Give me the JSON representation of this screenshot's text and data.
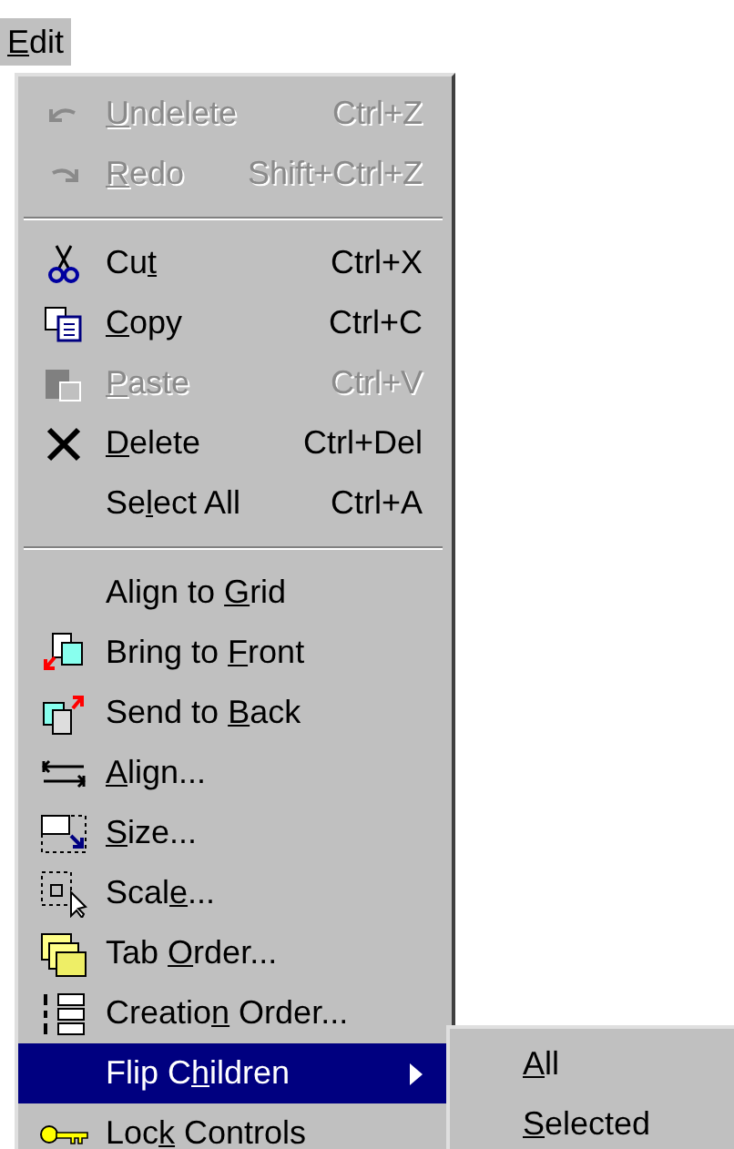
{
  "menu_bar": [
    {
      "label": {
        "key": "E",
        "after": "dit"
      },
      "selected": true
    }
  ],
  "menu": {
    "groups": [
      [
        {
          "kind": "command",
          "label": {
            "key": "U",
            "after": "ndelete"
          },
          "shortcut": "Ctrl+Z",
          "disabled": true
        },
        {
          "kind": "command",
          "label": {
            "key": "R",
            "after": "edo"
          },
          "shortcut": "Shift+Ctrl+Z",
          "disabled": true
        }
      ],
      [
        {
          "kind": "command",
          "label": {
            "before": "Cu",
            "key": "t"
          },
          "shortcut": "Ctrl+X",
          "disabled": false
        },
        {
          "kind": "command",
          "label": {
            "key": "C",
            "after": "opy"
          },
          "shortcut": "Ctrl+C",
          "disabled": false
        },
        {
          "kind": "command",
          "label": {
            "key": "P",
            "after": "aste"
          },
          "shortcut": "Ctrl+V",
          "disabled": true
        },
        {
          "kind": "command",
          "label": {
            "key": "D",
            "after": "elete"
          },
          "shortcut": "Ctrl+Del",
          "disabled": false
        },
        {
          "kind": "command",
          "label": {
            "before": "Se",
            "key": "l",
            "after": "ect All"
          },
          "shortcut": "Ctrl+A",
          "disabled": false
        }
      ],
      [
        {
          "kind": "command",
          "label": {
            "before": "Align to ",
            "key": "G",
            "after": "rid"
          },
          "disabled": false
        },
        {
          "kind": "command",
          "label": {
            "before": "Bring to ",
            "key": "F",
            "after": "ront"
          },
          "disabled": false
        },
        {
          "kind": "command",
          "label": {
            "before": "Send to ",
            "key": "B",
            "after": "ack"
          },
          "disabled": false
        },
        {
          "kind": "command",
          "label": {
            "key": "A",
            "after": "lign..."
          },
          "disabled": false
        },
        {
          "kind": "command",
          "label": {
            "key": "S",
            "after": "ize..."
          },
          "disabled": false
        },
        {
          "kind": "command",
          "label": {
            "before": "Scal",
            "key": "e",
            "after": "..."
          },
          "disabled": false
        },
        {
          "kind": "command",
          "label": {
            "before": "Tab ",
            "key": "O",
            "after": "rder..."
          },
          "disabled": false
        },
        {
          "kind": "command",
          "label": {
            "before": "Creatio",
            "key": "n",
            "after": " Order..."
          },
          "disabled": false
        },
        {
          "kind": "submenu",
          "label": {
            "before": "Flip C",
            "key": "h",
            "after": "ildren"
          },
          "selected": true
        },
        {
          "kind": "command",
          "label": {
            "before": "Loc",
            "key": "k",
            "after": " Controls"
          },
          "disabled": false
        }
      ]
    ]
  },
  "submenu": {
    "items": [
      {
        "label": {
          "key": "A",
          "after": "ll"
        }
      },
      {
        "label": {
          "key": "S",
          "after": "elected"
        }
      }
    ]
  }
}
